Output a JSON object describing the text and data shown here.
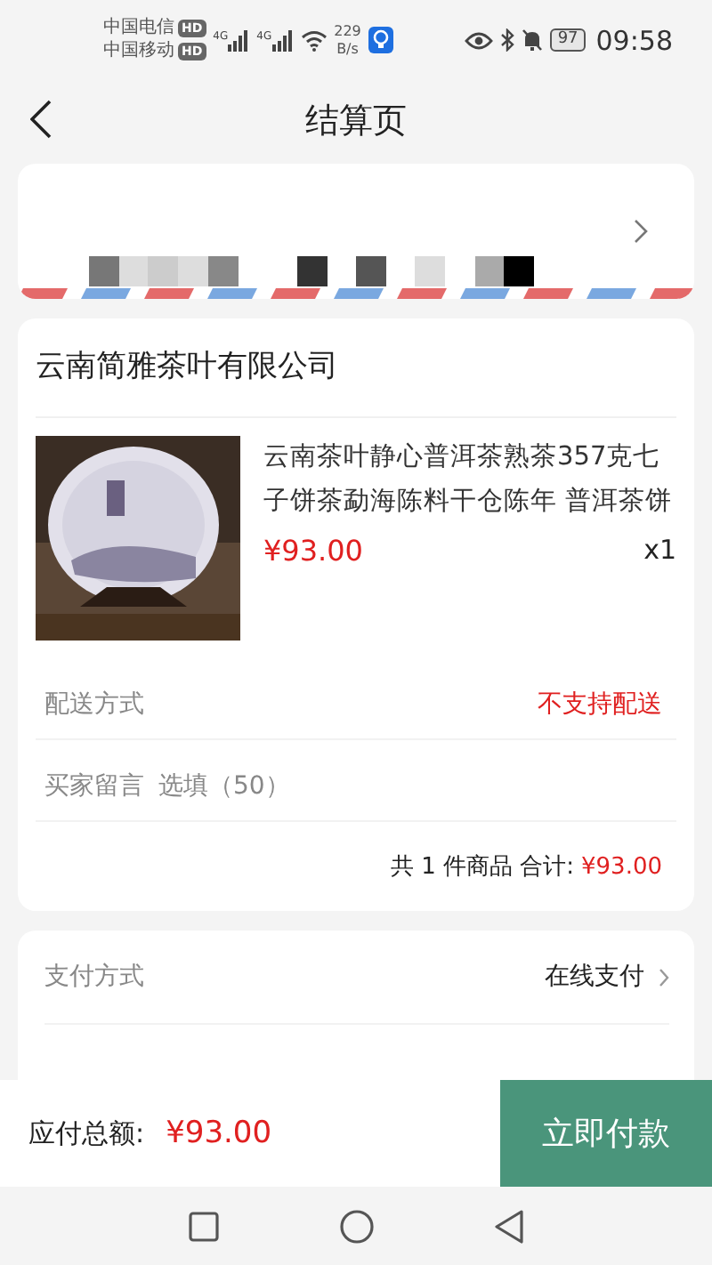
{
  "status_bar": {
    "carriers": [
      {
        "name": "中国电信",
        "badge": "HD"
      },
      {
        "name": "中国移动",
        "badge": "HD"
      }
    ],
    "networks": [
      "4G",
      "4G"
    ],
    "speed": "229",
    "speed_unit": "B/s",
    "battery": "97",
    "time": "09:58"
  },
  "header": {
    "title": "结算页"
  },
  "shop": {
    "name": "云南简雅茶叶有限公司",
    "product": {
      "title": "云南茶叶静心普洱茶熟茶357克七子饼茶勐海陈料干仓陈年 普洱茶饼",
      "price": "¥93.00",
      "quantity": "x1"
    },
    "rows": [
      {
        "kind": "value",
        "label": "配送方式",
        "value": "不支持配送"
      },
      {
        "kind": "input",
        "label": "买家留言",
        "placeholder": "选填（50）"
      }
    ],
    "summary": {
      "text": "共 1 件商品 合计:",
      "amount": "¥93.00"
    }
  },
  "payment": {
    "label": "支付方式",
    "value": "在线支付"
  },
  "bottom_bar": {
    "label": "应付总额:",
    "amount": "¥93.00",
    "button": "立即付款"
  }
}
